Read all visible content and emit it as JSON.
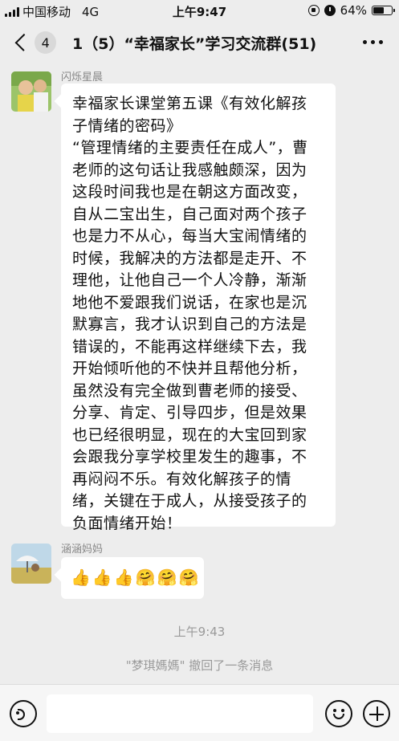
{
  "status_bar": {
    "carrier": "中国移动",
    "network": "4G",
    "time": "上午9:47",
    "battery": "64%",
    "battery_level": 0.64
  },
  "header": {
    "unread_count": "4",
    "title": "1（5）“幸福家长”学习交流群(51)"
  },
  "messages": [
    {
      "sender": "闪烁星晨",
      "text": "幸福家长课堂第五课《有效化解孩\n子情绪的密码》\n“管理情绪的主要责任在成人”，曹\n老师的这句话让我感触颇深，因为\n这段时间我也是在朝这方面改变，\n自从二宝出生，自己面对两个孩子\n也是力不从心，每当大宝闹情绪的\n时候，我解决的方法都是走开、不\n理他，让他自己一个人冷静，渐渐\n地他不爱跟我们说话，在家也是沉\n默寡言，我才认识到自己的方法是\n错误的，不能再这样继续下去，我\n开始倾听他的不快并且帮他分析，\n虽然没有完全做到曹老师的接受、\n分享、肯定、引导四步，但是效果\n也已经很明显，现在的大宝回到家\n会跟我分享学校里发生的趣事，不\n再闷闷不乐。有效化解孩子的情\n绪，关键在于成人，从接受孩子的\n负面情绪开始！"
    },
    {
      "sender": "涵涵妈妈",
      "emojis": [
        "👍",
        "👍",
        "👍",
        "🤗",
        "🤗",
        "🤗"
      ]
    }
  ],
  "system": {
    "time": "上午9:43",
    "recall_notice": "\"梦琪媽媽\" 撤回了一条消息"
  },
  "icons": {
    "back": "chevron-left-icon",
    "more": "more-dots-icon",
    "voice": "voice-icon",
    "emoji": "emoji-icon",
    "plus": "plus-icon"
  }
}
